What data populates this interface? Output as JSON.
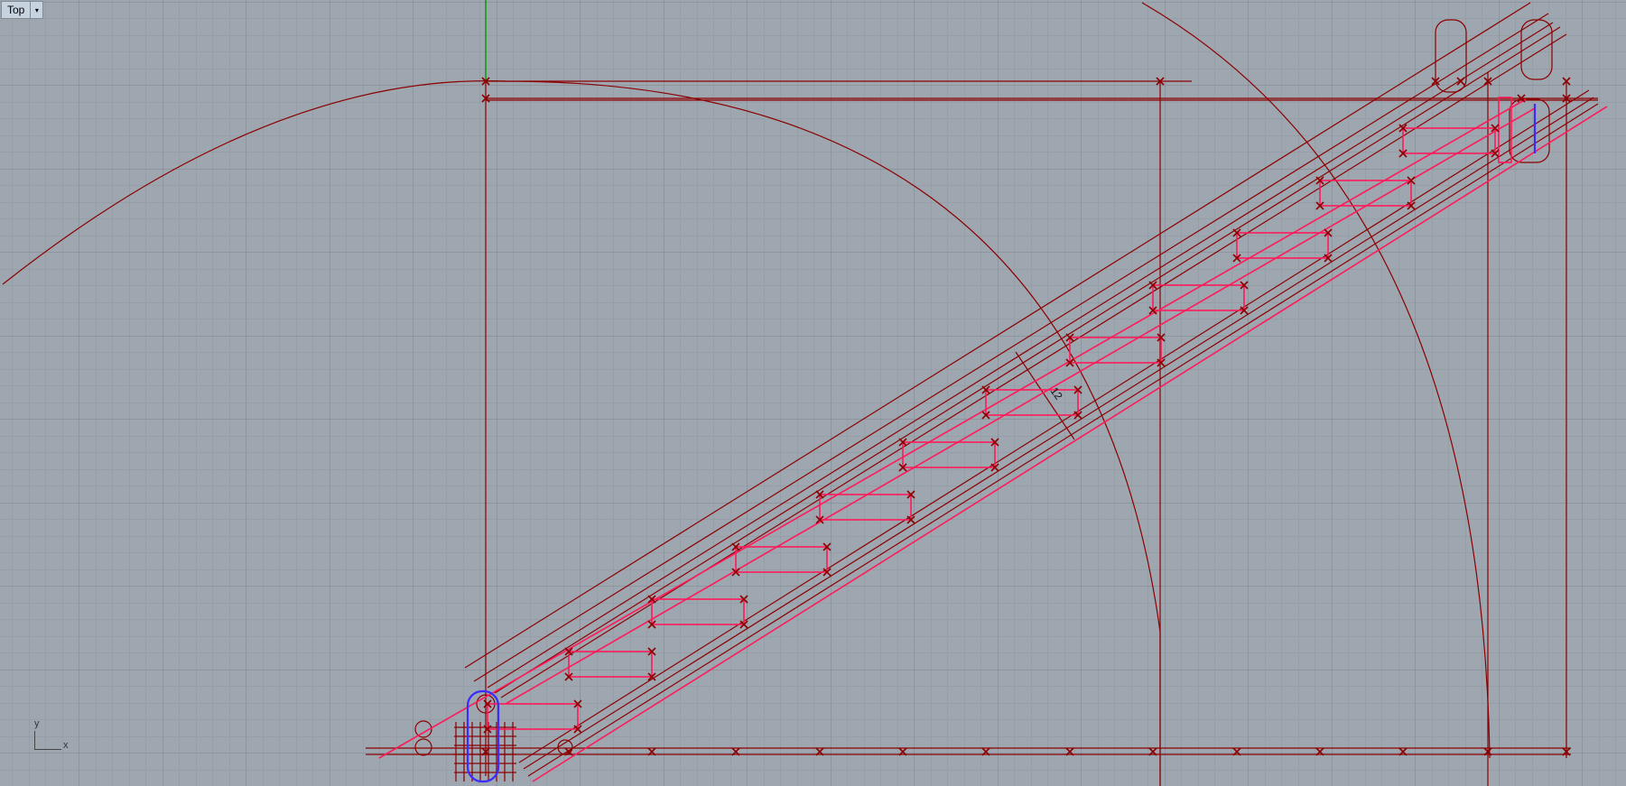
{
  "viewport": {
    "name": "Top",
    "menu_arrow": "▾"
  },
  "axes": {
    "x": "x",
    "y": "y"
  },
  "dimension_text": "12",
  "colors": {
    "background": "#9ea6b0",
    "grid_minor": "#8f969f",
    "grid_major": "#7e848c",
    "curve": "#8b0000",
    "selected": "#ff1a5a",
    "highlight": "#3a2cff",
    "world_y_axis": "#0a9a0a"
  }
}
